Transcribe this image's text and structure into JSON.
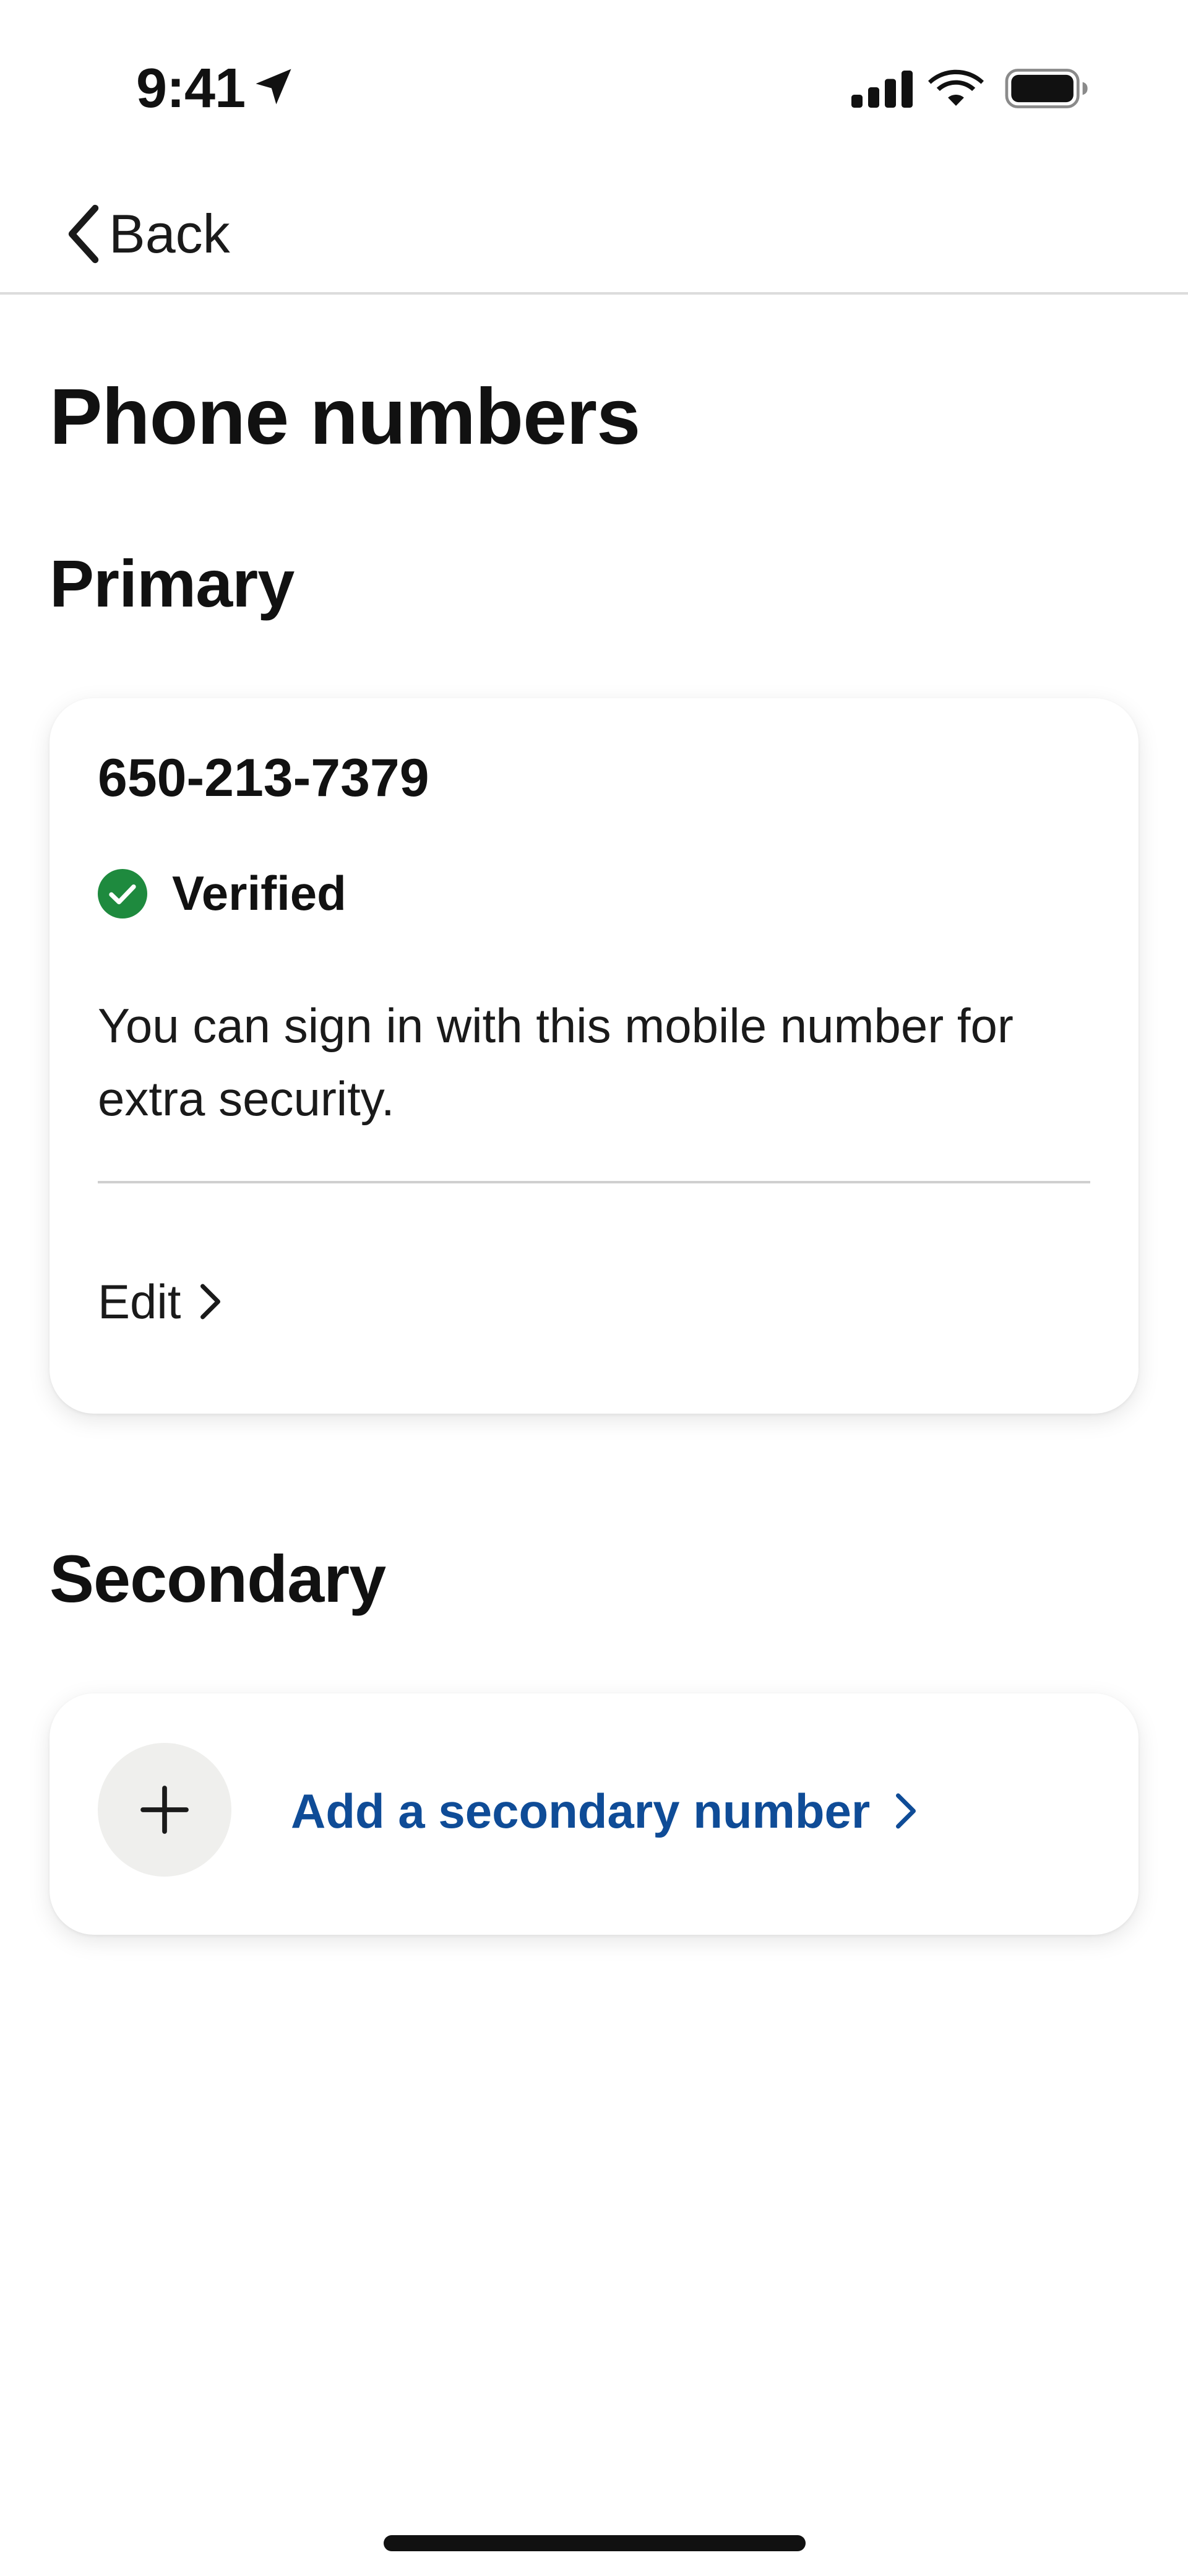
{
  "status_bar": {
    "time": "9:41",
    "icons": [
      "location-arrow-icon",
      "cellular-signal-icon",
      "wifi-icon",
      "battery-icon"
    ]
  },
  "nav": {
    "back_label": "Back",
    "back_icon": "chevron-left-icon"
  },
  "page": {
    "title": "Phone numbers"
  },
  "primary": {
    "heading": "Primary",
    "phone_number": "650-213-7379",
    "status_label": "Verified",
    "status_icon": "check-circle-icon",
    "description": "You can sign in with this mobile number for extra security.",
    "edit_label": "Edit",
    "edit_icon": "chevron-right-icon"
  },
  "secondary": {
    "heading": "Secondary",
    "add_icon": "plus-icon",
    "add_label": "Add a secondary number",
    "add_chevron_icon": "chevron-right-icon"
  },
  "colors": {
    "verified_green": "#1e8a3e",
    "link_blue": "#0f4c97",
    "add_circle_bg": "#efefed"
  }
}
